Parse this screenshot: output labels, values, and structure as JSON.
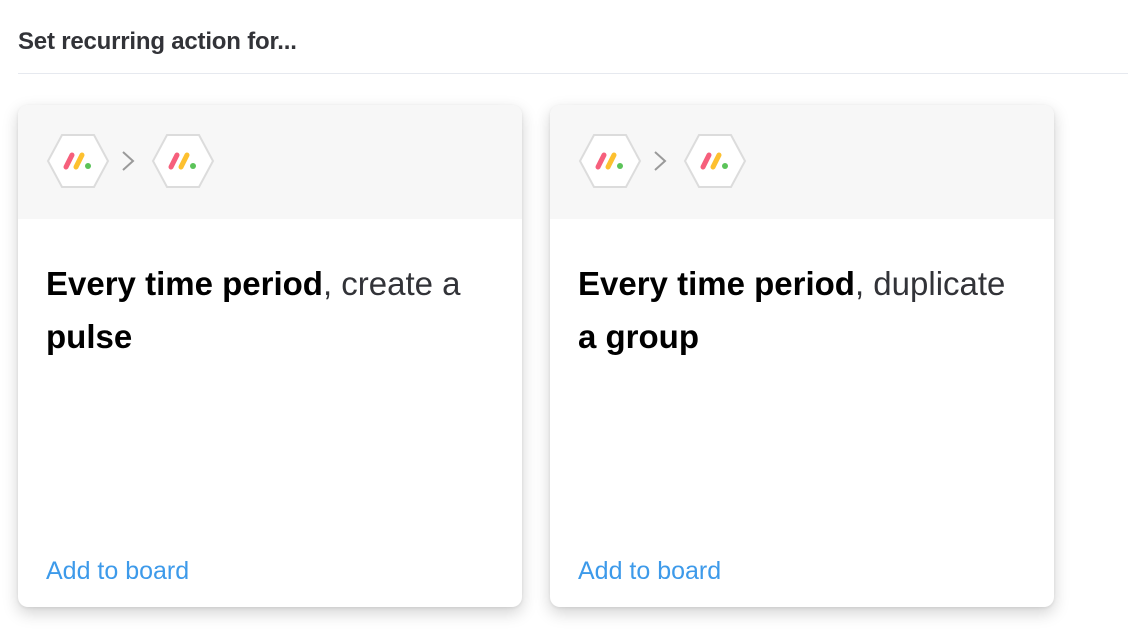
{
  "title": "Set recurring action for...",
  "recipes": [
    {
      "trigger": "Every time period",
      "separator": ",",
      "verb": "create a",
      "object": "pulse",
      "link": "Add to board"
    },
    {
      "trigger": "Every time period",
      "separator": ",",
      "verb": "duplicate",
      "object": "a group",
      "link": "Add to board"
    }
  ],
  "icons": {
    "app": "monday-logo-icon",
    "arrow": "chevron-right-icon"
  },
  "colors": {
    "link": "#3d9aea",
    "logo_red": "#f65f7c",
    "logo_yellow": "#fdc02f",
    "logo_green": "#5bc359"
  }
}
